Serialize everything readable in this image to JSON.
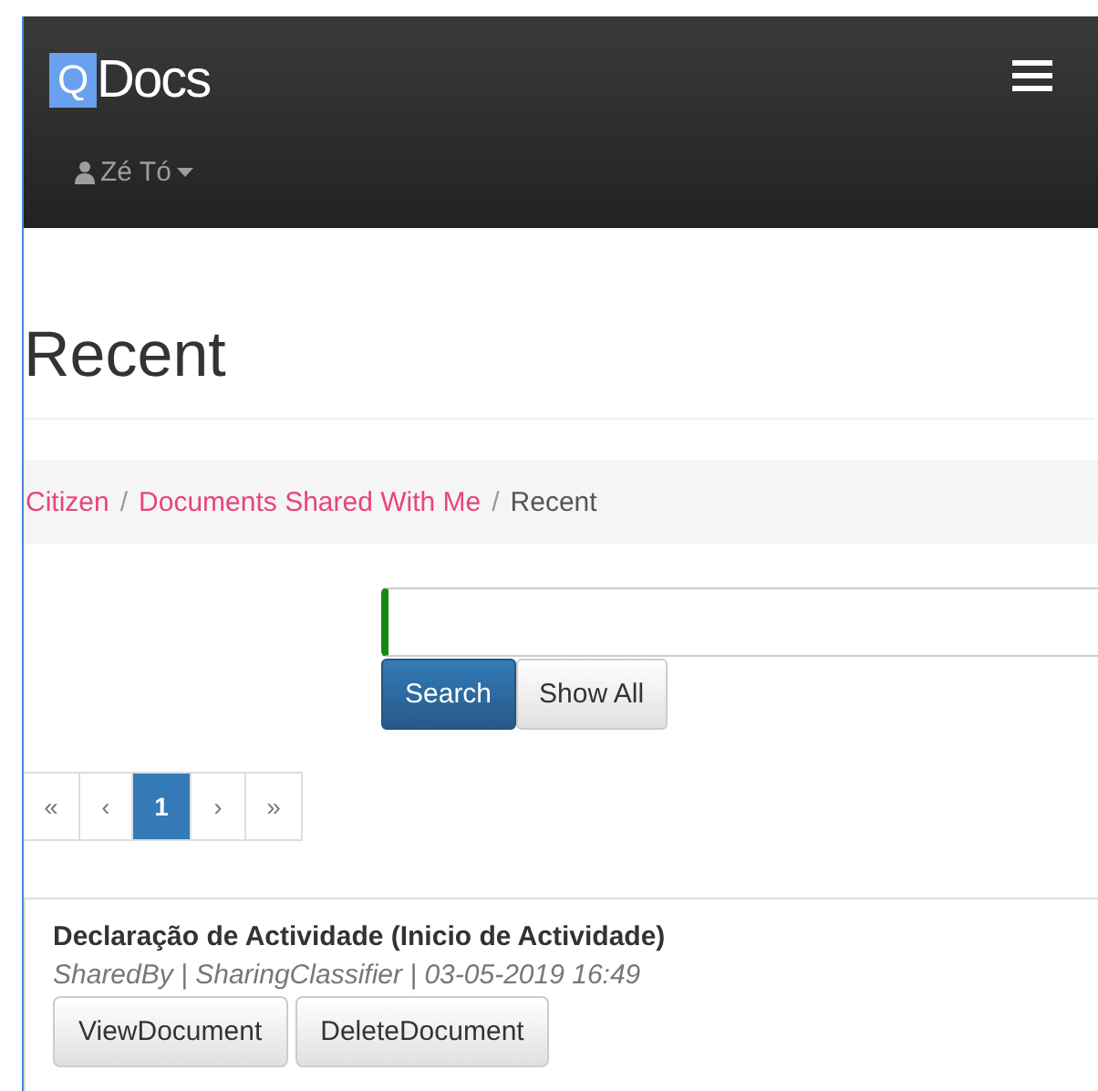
{
  "navbar": {
    "logo_mark": "Q",
    "logo_text": "Docs",
    "user": "Zé Tó"
  },
  "page_title": "Recent",
  "breadcrumb": [
    {
      "label": "Citizen",
      "kind": "link"
    },
    {
      "label": "Documents Shared With Me",
      "kind": "link"
    },
    {
      "label": "Recent",
      "kind": "current"
    }
  ],
  "breadcrumb_separator": "/",
  "search_buttons": [
    {
      "label": "Search",
      "kind": "primary"
    },
    {
      "label": "Show All",
      "kind": "default"
    }
  ],
  "pagination": [
    {
      "label": "«",
      "selected": false
    },
    {
      "label": "‹",
      "selected": false
    },
    {
      "label": "1",
      "selected": true
    },
    {
      "label": "›",
      "selected": false
    },
    {
      "label": "»",
      "selected": false
    }
  ],
  "documents": [
    {
      "title": "Declaração de Actividade (Inicio de Actividade)",
      "meta": "SharedBy | SharingClassifier | 03-05-2019 16:49",
      "actions": [
        "ViewDocument",
        "DeleteDocument"
      ]
    }
  ]
}
